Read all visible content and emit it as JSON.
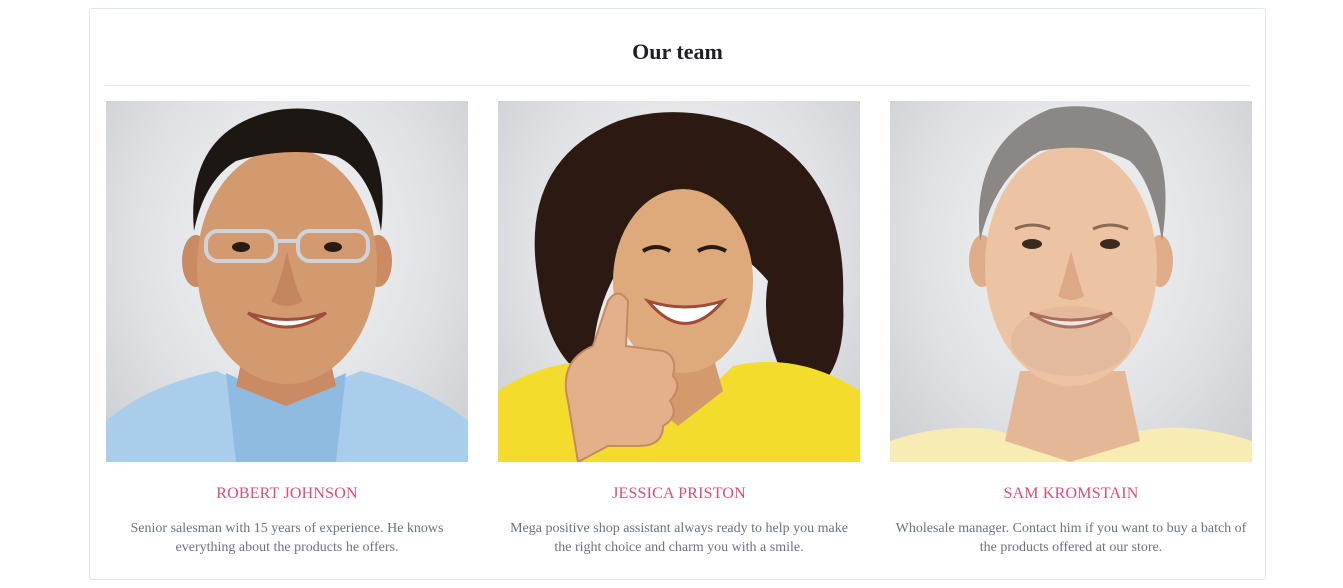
{
  "section": {
    "title": "Our team"
  },
  "members": [
    {
      "name": "ROBERT JOHNSON",
      "bio": "Senior salesman with 15 years of experience. He knows everything about the products he offers.",
      "photo_icon": "portrait-man-glasses",
      "shirt_color": "#a9cdea"
    },
    {
      "name": "JESSICA PRISTON",
      "bio": "Mega positive shop assistant always ready to help you make the right choice and charm you with a smile.",
      "photo_icon": "portrait-woman-thumbs-up",
      "shirt_color": "#f3dc2c"
    },
    {
      "name": "SAM KROMSTAIN",
      "bio": "Wholesale manager. Contact him if you want to buy a batch of the products offered at our store.",
      "photo_icon": "portrait-man-grey-hair",
      "shirt_color": "#f7ecb4"
    }
  ],
  "colors": {
    "name_accent": "#e04a78",
    "title": "#1e1e2a",
    "bio_text": "#6b7280",
    "panel_border": "#dde6f0"
  }
}
